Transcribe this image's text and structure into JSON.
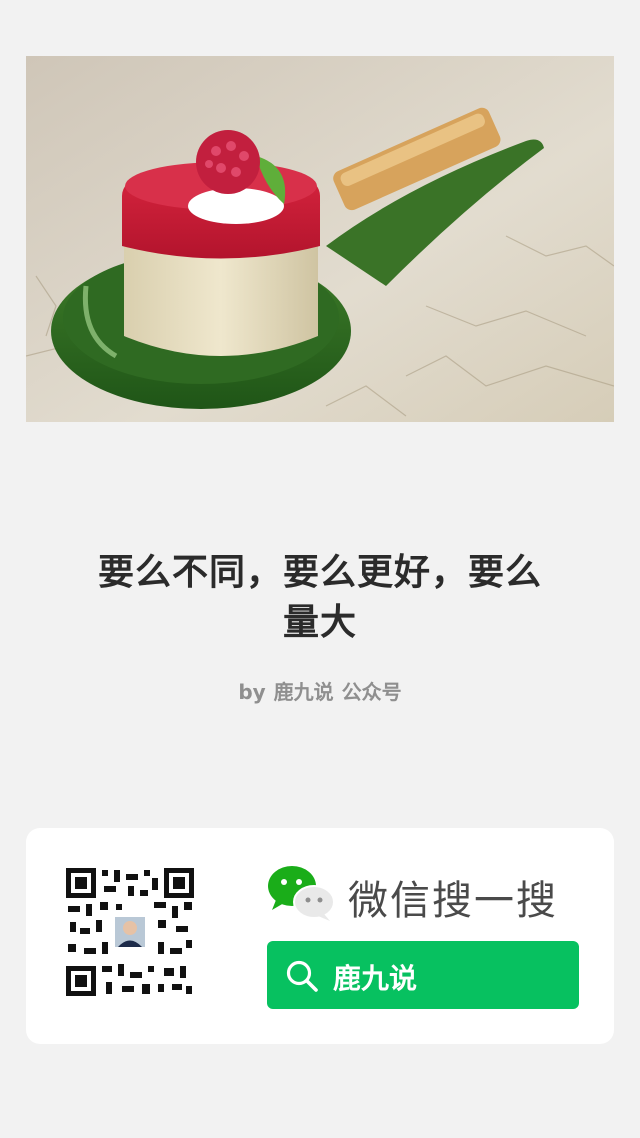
{
  "article": {
    "title_line1": "要么不同，要么更好，要么",
    "title_line2": "量大",
    "byline_prefix": "by",
    "author": "鹿九说",
    "account_type": "公众号"
  },
  "hero_image": {
    "subject": "raspberry mousse cake on a green spoon dish"
  },
  "footer_card": {
    "qr_code": "qr-code-icon",
    "logo": "wechat-icon",
    "search_heading": "微信搜一搜",
    "search_query": "鹿九说",
    "search_icon": "search-icon",
    "accent_color": "#07c160"
  }
}
